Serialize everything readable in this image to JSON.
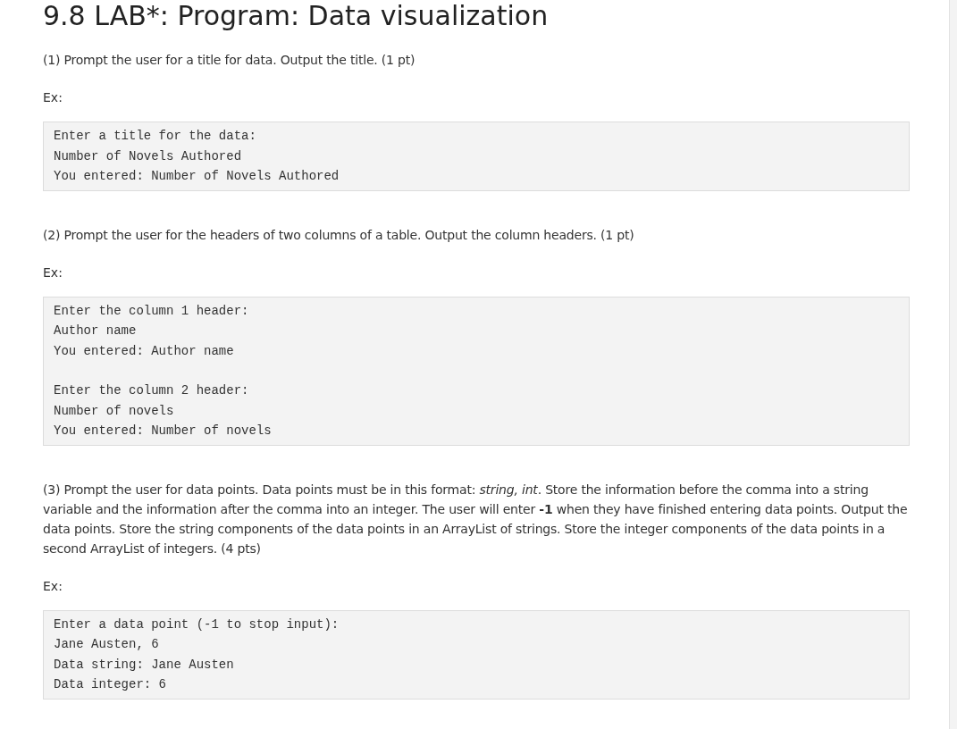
{
  "title": "9.8 LAB*: Program: Data visualization",
  "sections": [
    {
      "prompt": "(1) Prompt the user for a title for data. Output the title. (1 pt)",
      "example_label": "Ex:",
      "example_groups": [
        [
          "Enter a title for the data:",
          "Number of Novels Authored",
          "You entered: Number of Novels Authored"
        ]
      ]
    },
    {
      "prompt": "(2) Prompt the user for the headers of two columns of a table. Output the column headers. (1 pt)",
      "example_label": "Ex:",
      "example_groups": [
        [
          "Enter the column 1 header:",
          "Author name",
          "You entered: Author name"
        ],
        [
          "Enter the column 2 header:",
          "Number of novels",
          "You entered: Number of novels"
        ]
      ]
    },
    {
      "prompt": "(3) Prompt the user for data points. Data points must be in this format: *string, int*. Store the information before the comma into a string variable and the information after the comma into an integer. The user will enter **-1** when they have finished entering data points. Output the data points. Store the string components of the data points in an ArrayList of strings. Store the integer components of the data points in a second ArrayList of integers. (4 pts)",
      "example_label": "Ex:",
      "example_groups": [
        [
          "Enter a data point (-1 to stop input):",
          "Jane Austen, 6",
          "Data string: Jane Austen",
          "Data integer: 6"
        ]
      ]
    }
  ]
}
